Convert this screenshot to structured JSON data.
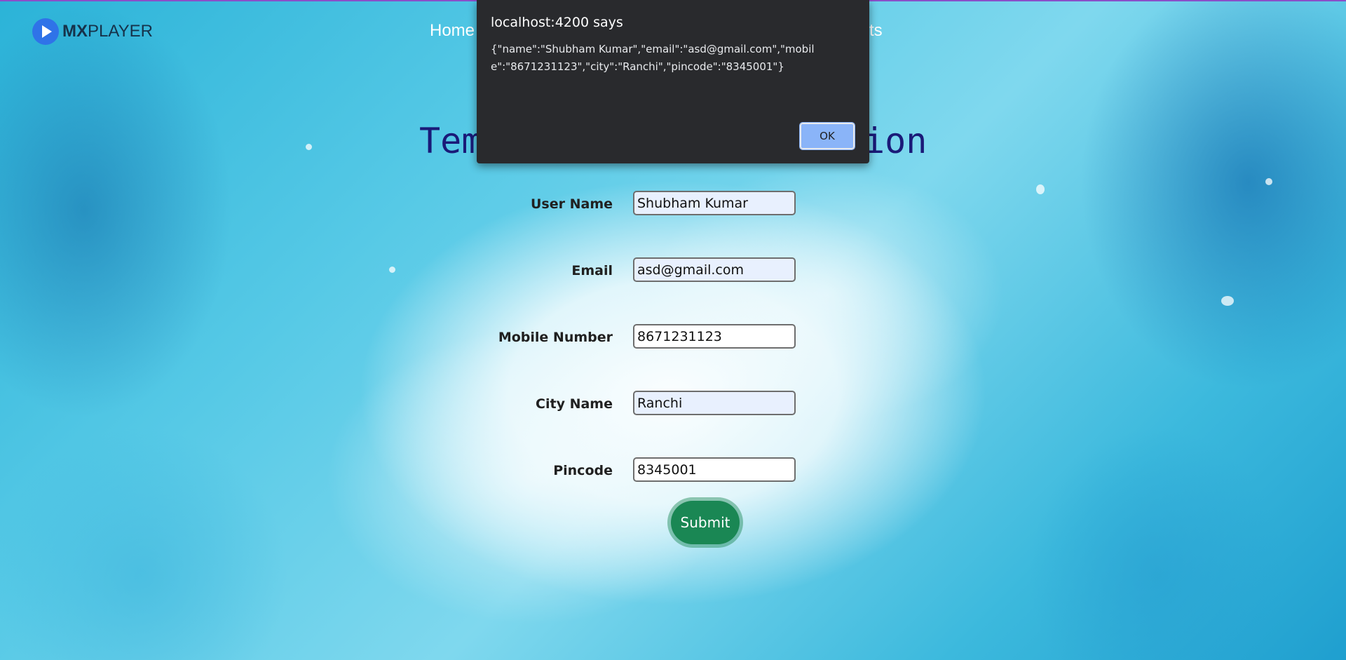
{
  "navbar": {
    "logo_strong": "MX",
    "logo_rest": "PLAYER",
    "links": [
      {
        "label": "Home"
      },
      {
        "label": "cts"
      }
    ]
  },
  "main": {
    "heading_left": "Tem",
    "heading_right": "ion"
  },
  "form": {
    "fields": [
      {
        "label": "User Name",
        "value": "Shubham Kumar"
      },
      {
        "label": "Email",
        "value": "asd@gmail.com"
      },
      {
        "label": "Mobile Number",
        "value": "8671231123"
      },
      {
        "label": "City Name",
        "value": "Ranchi"
      },
      {
        "label": "Pincode",
        "value": "8345001"
      }
    ],
    "submit_label": "Submit"
  },
  "dialog": {
    "title": "localhost:4200 says",
    "message": "{\"name\":\"Shubham Kumar\",\"email\":\"asd@gmail.com\",\"mobile\":\"8671231123\",\"city\":\"Ranchi\",\"pincode\":\"8345001\"}",
    "ok_label": "OK"
  },
  "colors": {
    "dialog_bg": "#292a2d",
    "ok_button": "#8ab4f8",
    "submit_button": "#1a8754",
    "heading": "#1a1a78",
    "logo_icon": "#2f73e8"
  }
}
